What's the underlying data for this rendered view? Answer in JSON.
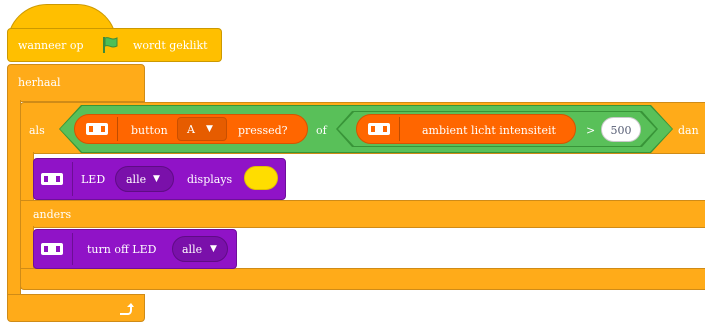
{
  "hat": {
    "prefix": "wanneer op",
    "suffix": "wordt geklikt",
    "flag_icon": "green-flag-icon",
    "flag_color": "#4cbf56"
  },
  "repeat": {
    "label": "herhaal",
    "loop_icon": "loop-arrow-icon"
  },
  "if_else": {
    "if_label": "als",
    "then_label": "dan",
    "else_label": "anders"
  },
  "condition": {
    "operator_or": "of",
    "button": {
      "label": "button",
      "value": "A",
      "suffix": "pressed?"
    },
    "compare": {
      "sensor_label": "ambient licht intensiteit",
      "operator": ">",
      "value": "500"
    }
  },
  "led_display": {
    "label": "LED",
    "target": "alle",
    "action": "displays",
    "color": "#ffdd00"
  },
  "led_off": {
    "label": "turn off LED",
    "target": "alle"
  },
  "colors": {
    "events": "#ffbf00",
    "control": "#ffab19",
    "operators": "#59c059",
    "sensing": "#ff6600",
    "looks": "#9013c7"
  }
}
